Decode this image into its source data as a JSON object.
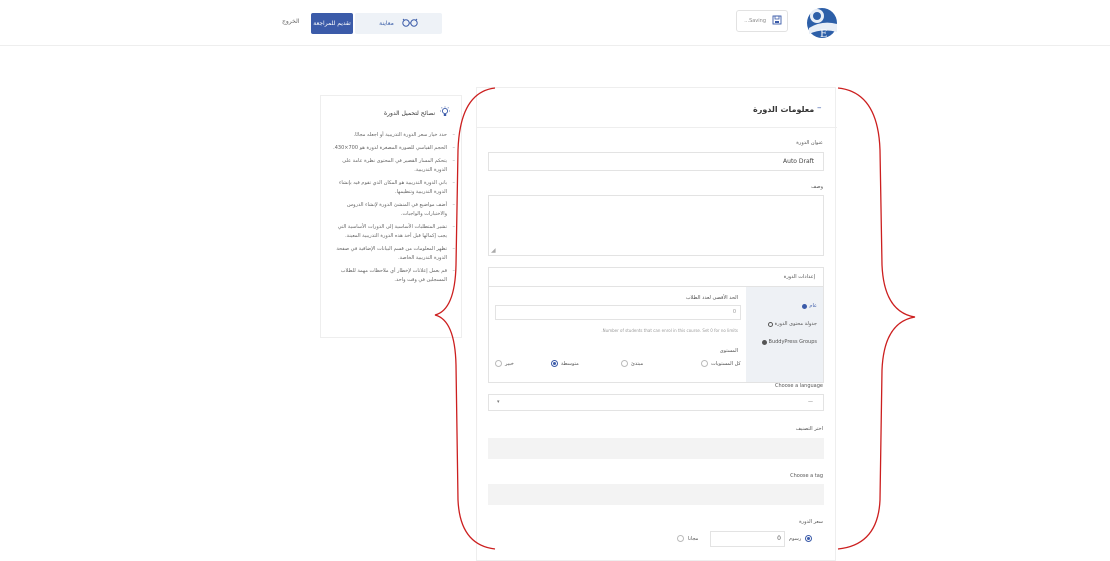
{
  "header": {
    "save_label": "...Saving",
    "preview_label": "معاينة",
    "submit_label": "تقديم للمراجعة",
    "exit_label": "الخروج"
  },
  "tips": {
    "title": "نصائح لتحميل الدورة",
    "items": [
      "حدد خيار سعر الدورة التدريبية أو اجعله مجانًا.",
      "الحجم القياسي للصورة المصغرة لدورة هو 700×430.",
      "يتحكم المسار القصير في المحتوى نظرة عامة على الدورة التدريبية.",
      "باني الدورة التدريبية هو المكان الذي تقوم فيه بإنشاء الدورة التدريبية وتنظيمها.",
      "أضف مواضيع في المنشئ الدورة لإنشاء الدروس والاختبارات والواجبات.",
      "تشير المتطلبات الأساسية إلى الدورات الأساسية التي يجب إكمالها قبل أخذ هذه الدورة التدريبية المعينة.",
      "تظهر المعلومات من قسم البيانات الإضافية في صفحة الدورة التدريبية الخاصة.",
      "قم بعمل إعلانات لإخطار أي ملاحظات مهمة للطلاب المسجلين في وقت واحد."
    ]
  },
  "course": {
    "section_title": "معلومات الدورة",
    "toggle": "–",
    "title_label": "عنوان الدورة",
    "title_value": "Auto Draft",
    "description_label": "وصف",
    "settings": {
      "title": "إعدادات الدورة",
      "tabs": [
        "عام",
        "جدولة محتوى الدورة",
        "BuddyPress Groups"
      ],
      "max_students_label": "الحد الأقصى لعدد الطلاب",
      "max_students_value": "0",
      "max_students_help": ".Number of students that can enrol in this course. Set 0 for no limits",
      "level_label": "المستوى",
      "levels": [
        "كل المستويات",
        "مبتدئ",
        "متوسطة",
        "خبير"
      ],
      "level_selected": "متوسطة"
    },
    "language_label": "Choose a language",
    "language_value": "—",
    "category_label": "اختر التصنيف",
    "tag_label": "Choose a tag",
    "price_label": "سعر الدورة",
    "paid_label": "رسوم",
    "price_value": "0",
    "free_label": "مجانا"
  },
  "colors": {
    "accent": "#3b5ba9",
    "annotation": "#cc1f1f",
    "border": "#e3e3e3",
    "side_bg": "#eef1f5"
  }
}
